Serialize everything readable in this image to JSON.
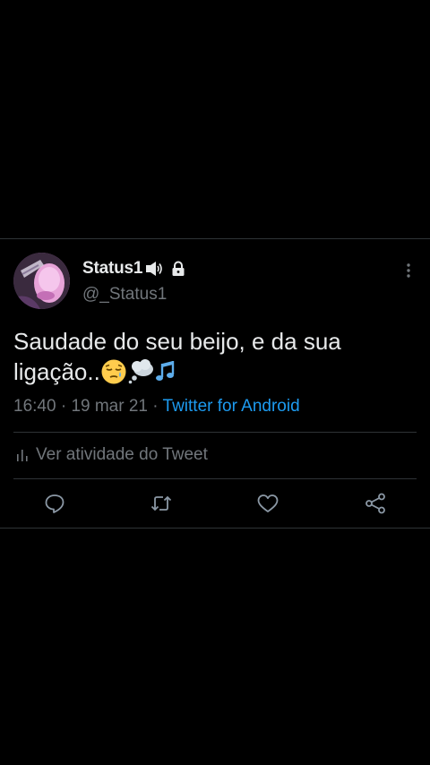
{
  "user": {
    "display_name": "Status1",
    "handle": "@_Status1",
    "badges": [
      "speaker-emoji",
      "lock-icon"
    ]
  },
  "tweet": {
    "text": "Saudade do seu beijo, e da sua ligação..",
    "emojis": [
      "pensive-face-emoji",
      "thought-balloon-emoji",
      "musical-notes-emoji"
    ],
    "time": "16:40",
    "date": "19 mar 21",
    "separator": "·",
    "source": "Twitter for Android"
  },
  "activity": {
    "label": "Ver atividade do Tweet"
  },
  "actions": [
    {
      "name": "reply",
      "icon": "reply-icon"
    },
    {
      "name": "retweet",
      "icon": "retweet-icon"
    },
    {
      "name": "like",
      "icon": "heart-icon"
    },
    {
      "name": "share",
      "icon": "share-icon"
    }
  ],
  "colors": {
    "background": "#000000",
    "text": "#e7e9ea",
    "secondary": "#71767b",
    "link": "#1d9bf0",
    "divider": "#2f3336"
  }
}
